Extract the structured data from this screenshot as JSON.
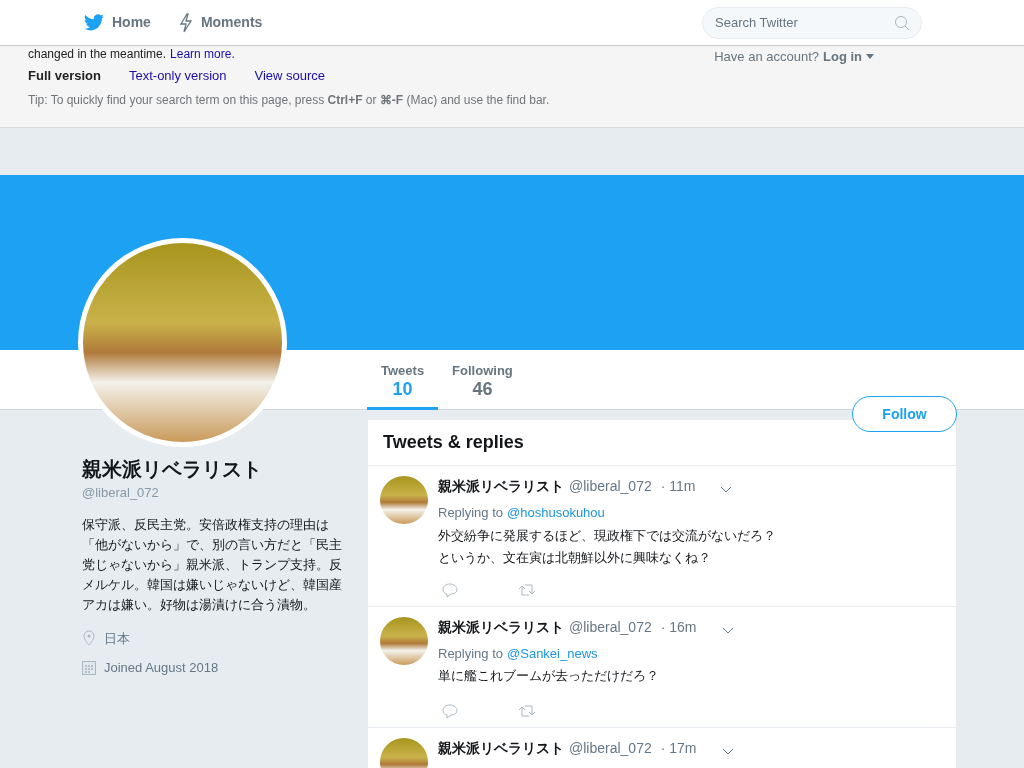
{
  "header": {
    "nav": [
      {
        "kind": "bird",
        "label": "Home"
      },
      {
        "kind": "bolt",
        "label": "Moments"
      }
    ],
    "search": {
      "placeholder": "Search Twitter"
    }
  },
  "notice": {
    "cut_line": "changed in the meantime.",
    "cut_link": "Learn more.",
    "versions": [
      {
        "label": "Full version",
        "selected": true
      },
      {
        "label": "Text-only version",
        "selected": false
      },
      {
        "label": "View source",
        "selected": false
      }
    ],
    "tip": "Tip: To quickly find your search term on this page, press **Ctrl+F** or **⌘-F** (Mac) and use the find bar.",
    "account_prompt": "Have an account?",
    "login": "Log in"
  },
  "profile": {
    "name": "親米派リベラリスト",
    "handle": "@liberal_072",
    "bio": "保守派、反民主党。安倍政権支持の理由は「他がないから」で、別の言い方だと「民主党じゃないから」親米派、トランプ支持。反メルケル。韓国は嫌いじゃないけど、韓国産アカは嫌い。好物は湯漬けに合う漬物。",
    "location": "日本",
    "joined": "Joined August 2018"
  },
  "tabs": [
    {
      "label": "Tweets",
      "count": "10",
      "selected": true
    },
    {
      "label": "Following",
      "count": "46",
      "selected": false
    }
  ],
  "follow_button": "Follow",
  "timeline": {
    "title": "Tweets & replies",
    "tweets": [
      {
        "name": "親米派リベラリスト",
        "handle": "@liberal_072",
        "time": "· 11m",
        "replying_label": "Replying to",
        "replying_to": "@hoshusokuhou",
        "lines": [
          "外交紛争に発展するほど、現政権下では交流がないだろ？",
          "というか、文在寅は北朝鮮以外に興味なくね？"
        ]
      },
      {
        "name": "親米派リベラリスト",
        "handle": "@liberal_072",
        "time": "· 16m",
        "replying_label": "Replying to",
        "replying_to": "@Sankei_news",
        "lines": [
          "単に艦これブームが去っただけだろ？"
        ]
      },
      {
        "name": "親米派リベラリスト",
        "handle": "@liberal_072",
        "time": "· 17m"
      }
    ]
  }
}
